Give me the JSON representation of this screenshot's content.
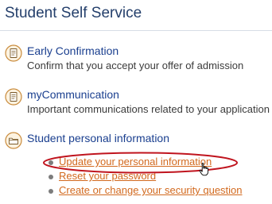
{
  "page": {
    "title": "Student Self Service"
  },
  "sections": [
    {
      "title": "Early Confirmation",
      "description": "Confirm that you accept your offer of admission",
      "icon": "document-icon"
    },
    {
      "title": "myCommunication",
      "description": "Important communications related to your application",
      "icon": "document-icon"
    },
    {
      "title": "Student personal information",
      "icon": "folder-icon",
      "links": [
        {
          "label": "Update your personal information",
          "highlighted": true
        },
        {
          "label": "Reset your password"
        },
        {
          "label": "Create or change your security question"
        }
      ]
    }
  ],
  "colors": {
    "title": "#243f6b",
    "link": "#d2691e",
    "highlight_ellipse": "#c0141e",
    "icon_badge": "#e8a54b"
  },
  "cursor": "hand-pointer-icon"
}
